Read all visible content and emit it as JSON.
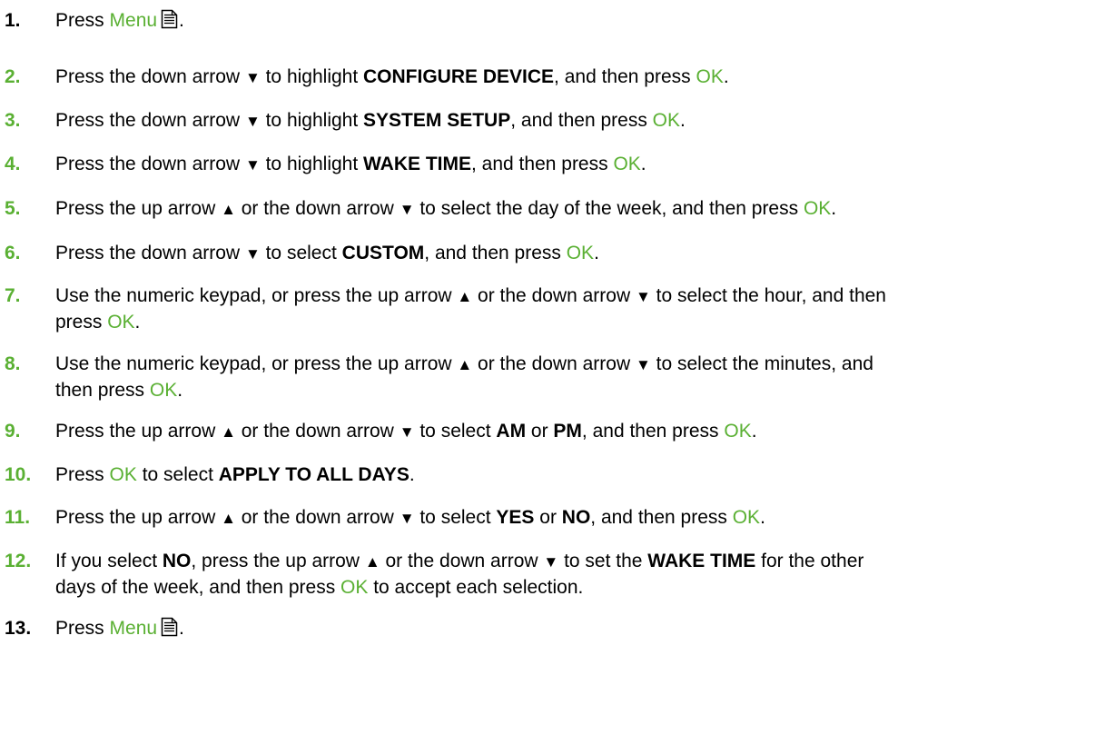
{
  "colors": {
    "accent": "#5ab033",
    "text": "#000000"
  },
  "icons": {
    "menu": "menu-icon",
    "up": "▲",
    "down": "▼"
  },
  "steps": [
    {
      "number": "1.",
      "parts": [
        {
          "t": "Press "
        },
        {
          "t": "Menu",
          "s": "g"
        },
        {
          "icon": "menu"
        },
        {
          "t": "."
        }
      ]
    },
    {
      "number": "2.",
      "parts": [
        {
          "t": "Press the down arrow "
        },
        {
          "icon": "down"
        },
        {
          "t": " to highlight "
        },
        {
          "t": "CONFIGURE DEVICE",
          "s": "b"
        },
        {
          "t": ", and then press "
        },
        {
          "t": "OK",
          "s": "g"
        },
        {
          "t": "."
        }
      ]
    },
    {
      "number": "3.",
      "parts": [
        {
          "t": "Press the down arrow "
        },
        {
          "icon": "down"
        },
        {
          "t": " to highlight "
        },
        {
          "t": "SYSTEM SETUP",
          "s": "b"
        },
        {
          "t": ", and then press "
        },
        {
          "t": "OK",
          "s": "g"
        },
        {
          "t": "."
        }
      ]
    },
    {
      "number": "4.",
      "parts": [
        {
          "t": "Press the down arrow "
        },
        {
          "icon": "down"
        },
        {
          "t": " to highlight "
        },
        {
          "t": "WAKE TIME",
          "s": "b"
        },
        {
          "t": ", and then press "
        },
        {
          "t": "OK",
          "s": "g"
        },
        {
          "t": "."
        }
      ]
    },
    {
      "number": "5.",
      "parts": [
        {
          "t": "Press the up arrow "
        },
        {
          "icon": "up"
        },
        {
          "t": " or the down arrow "
        },
        {
          "icon": "down"
        },
        {
          "t": " to select the day of the week, and then press "
        },
        {
          "t": "OK",
          "s": "g"
        },
        {
          "t": "."
        }
      ]
    },
    {
      "number": "6.",
      "parts": [
        {
          "t": "Press the down arrow "
        },
        {
          "icon": "down"
        },
        {
          "t": " to select "
        },
        {
          "t": "CUSTOM",
          "s": "b"
        },
        {
          "t": ", and then press "
        },
        {
          "t": "OK",
          "s": "g"
        },
        {
          "t": "."
        }
      ]
    },
    {
      "number": "7.",
      "parts": [
        {
          "t": "Use the numeric keypad, or press the up arrow "
        },
        {
          "icon": "up"
        },
        {
          "t": " or the down arrow "
        },
        {
          "icon": "down"
        },
        {
          "t": " to select the hour, and then"
        },
        {
          "br": true
        },
        {
          "t": "press "
        },
        {
          "t": "OK",
          "s": "g"
        },
        {
          "t": "."
        }
      ]
    },
    {
      "number": "8.",
      "parts": [
        {
          "t": "Use the numeric keypad, or press the up arrow "
        },
        {
          "icon": "up"
        },
        {
          "t": " or the down arrow "
        },
        {
          "icon": "down"
        },
        {
          "t": " to select the minutes, and"
        },
        {
          "br": true
        },
        {
          "t": "then press "
        },
        {
          "t": "OK",
          "s": "g"
        },
        {
          "t": "."
        }
      ]
    },
    {
      "number": "9.",
      "parts": [
        {
          "t": "Press the up arrow "
        },
        {
          "icon": "up"
        },
        {
          "t": " or the down arrow "
        },
        {
          "icon": "down"
        },
        {
          "t": " to select "
        },
        {
          "t": "AM",
          "s": "b"
        },
        {
          "t": " or "
        },
        {
          "t": "PM",
          "s": "b"
        },
        {
          "t": ", and then press "
        },
        {
          "t": "OK",
          "s": "g"
        },
        {
          "t": "."
        }
      ]
    },
    {
      "number": "10.",
      "parts": [
        {
          "t": "Press "
        },
        {
          "t": "OK",
          "s": "g"
        },
        {
          "t": " to select "
        },
        {
          "t": "APPLY TO ALL DAYS",
          "s": "b"
        },
        {
          "t": "."
        }
      ]
    },
    {
      "number": "11.",
      "parts": [
        {
          "t": "Press the up arrow "
        },
        {
          "icon": "up"
        },
        {
          "t": " or the down arrow "
        },
        {
          "icon": "down"
        },
        {
          "t": " to select "
        },
        {
          "t": "YES",
          "s": "b"
        },
        {
          "t": " or "
        },
        {
          "t": "NO",
          "s": "b"
        },
        {
          "t": ", and then press "
        },
        {
          "t": "OK",
          "s": "g"
        },
        {
          "t": "."
        }
      ]
    },
    {
      "number": "12.",
      "parts": [
        {
          "t": "If you select "
        },
        {
          "t": "NO",
          "s": "b"
        },
        {
          "t": ", press the up arrow "
        },
        {
          "icon": "up"
        },
        {
          "t": " or the down arrow "
        },
        {
          "icon": "down"
        },
        {
          "t": " to set the "
        },
        {
          "t": "WAKE TIME",
          "s": "b"
        },
        {
          "t": " for the other"
        },
        {
          "br": true
        },
        {
          "t": "days of the week, and then press "
        },
        {
          "t": "OK",
          "s": "g"
        },
        {
          "t": " to accept each selection."
        }
      ]
    },
    {
      "number": "13.",
      "parts": [
        {
          "t": "Press "
        },
        {
          "t": "Menu",
          "s": "g"
        },
        {
          "icon": "menu"
        },
        {
          "t": "."
        }
      ]
    }
  ]
}
